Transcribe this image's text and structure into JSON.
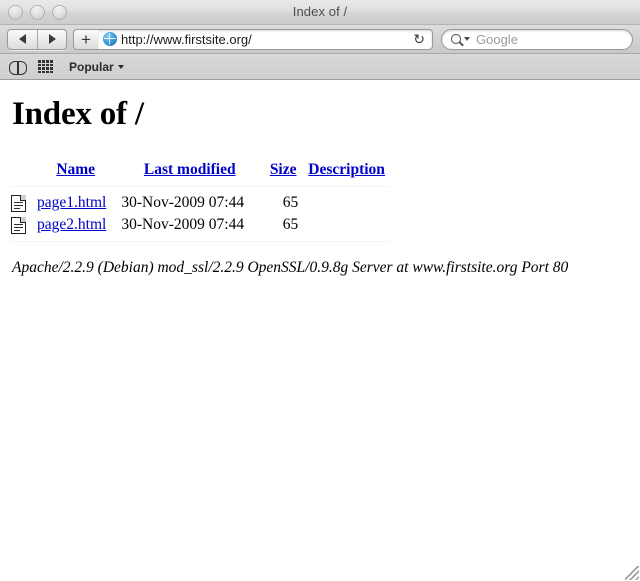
{
  "window": {
    "title": "Index of /",
    "traffic_lights": [
      "close",
      "minimize",
      "zoom"
    ]
  },
  "toolbar": {
    "back_label": "◀",
    "forward_label": "▶",
    "add_label": "+",
    "url": "http://www.firstsite.org/",
    "reload_label": "↻",
    "search_placeholder": "Google",
    "favicon": "globe-icon"
  },
  "bookmarks_bar": {
    "show_all_bookmarks_icon": "book-icon",
    "top_sites_icon": "grid-icon",
    "popular_label": "Popular",
    "popular_caret": "▾"
  },
  "page": {
    "heading": "Index of /",
    "columns": {
      "name": "Name",
      "last_modified": "Last modified",
      "size": "Size",
      "description": "Description"
    },
    "rows": [
      {
        "icon": "document-icon",
        "name": "page1.html",
        "last_modified": "30-Nov-2009 07:44",
        "size": "65",
        "description": ""
      },
      {
        "icon": "document-icon",
        "name": "page2.html",
        "last_modified": "30-Nov-2009 07:44",
        "size": "65",
        "description": ""
      }
    ],
    "signature": "Apache/2.2.9 (Debian) mod_ssl/2.2.9 OpenSSL/0.9.8g Server at www.firstsite.org Port 80"
  },
  "colors": {
    "link": "#0000cc",
    "content_bg": "#fffffd",
    "chrome_bg": "#d2d2d2",
    "title_text": "#4e4e4e"
  }
}
